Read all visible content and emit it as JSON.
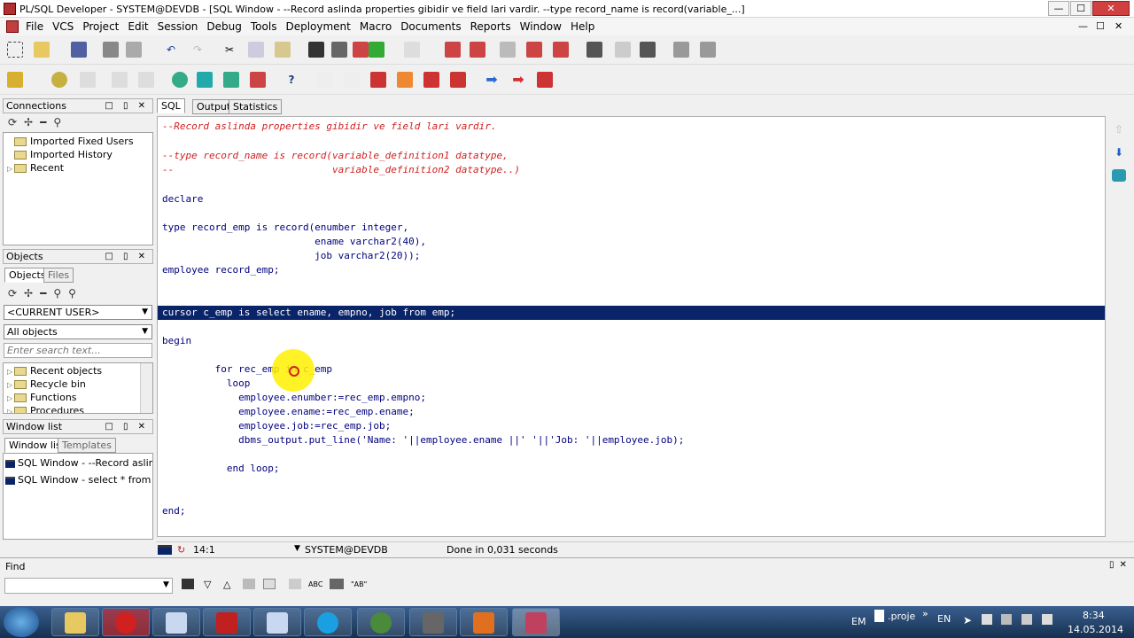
{
  "window": {
    "title": "PL/SQL Developer - SYSTEM@DEVDB - [SQL Window - --Record aslinda properties gibidir ve field lari vardir. --type record_name is record(variable_...]",
    "min": "—",
    "max": "☐",
    "close": "✕",
    "inner_min": "—",
    "inner_max": "☐",
    "inner_close": "✕"
  },
  "menu": [
    "File",
    "VCS",
    "Project",
    "Edit",
    "Session",
    "Debug",
    "Tools",
    "Deployment",
    "Macro",
    "Documents",
    "Reports",
    "Window",
    "Help"
  ],
  "connections": {
    "title": "Connections",
    "items": [
      "Imported Fixed Users",
      "Imported History",
      "Recent"
    ]
  },
  "objects": {
    "title": "Objects",
    "tabs": [
      "Objects",
      "Files"
    ],
    "user_select": "<CURRENT USER>",
    "type_select": "All objects",
    "search_placeholder": "Enter search text...",
    "items": [
      "Recent objects",
      "Recycle bin",
      "Functions",
      "Procedures"
    ]
  },
  "windowlist": {
    "title": "Window list",
    "tabs": [
      "Window list",
      "Templates"
    ],
    "items": [
      "SQL Window - --Record aslinda pr",
      "SQL Window - select * from emp"
    ]
  },
  "editor_tabs": [
    "SQL",
    "Output",
    "Statistics"
  ],
  "code": {
    "l1": "--Record aslinda properties gibidir ve field lari vardir.",
    "l2": "--type record_name is record(variable_definition1 datatype,",
    "l3": "--                           variable_definition2 datatype..)",
    "l4": "declare",
    "l5": "type record_emp is record(enumber integer,",
    "l6": "                          ename varchar2(40),",
    "l7": "                          job varchar2(20));",
    "l8": "employee record_emp;",
    "l9": "cursor c_emp is select ename, empno, job from emp;",
    "l10": "begin",
    "l11": "         for rec_emp in c_emp",
    "l12": "           loop",
    "l13": "             employee.enumber:=rec_emp.empno;",
    "l14": "             employee.ename:=rec_emp.ename;",
    "l15": "             employee.job:=rec_emp.job;",
    "l16": "             dbms_output.put_line('Name: '||employee.ename ||' '||'Job: '||employee.job);",
    "l17": "           end loop;",
    "l18": "end;"
  },
  "status": {
    "position": "14:1",
    "connection": "SYSTEM@DEVDB",
    "message": "Done in 0,031 seconds"
  },
  "find": {
    "title": "Find",
    "value": ""
  },
  "tray": {
    "lang1": "EM",
    "doc": ".proje",
    "lang2": "EN",
    "time": "8:34",
    "date": "14.05.2014"
  },
  "colors": {
    "selection": "#0a246a",
    "comment": "#d02020",
    "code": "#000080"
  }
}
